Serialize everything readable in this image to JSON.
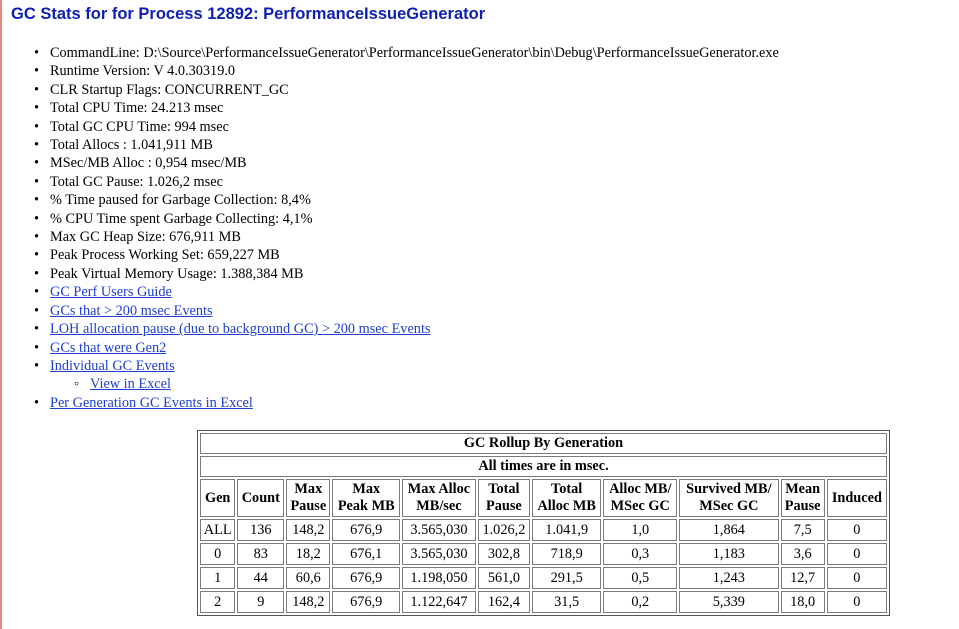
{
  "title": "GC Stats for for Process 12892: PerformanceIssueGenerator",
  "stats": [
    "CommandLine: D:\\Source\\PerformanceIssueGenerator\\PerformanceIssueGenerator\\bin\\Debug\\PerformanceIssueGenerator.exe",
    "Runtime Version: V 4.0.30319.0",
    "CLR Startup Flags: CONCURRENT_GC",
    "Total CPU Time: 24.213 msec",
    "Total GC CPU Time: 994 msec",
    "Total Allocs : 1.041,911 MB",
    "MSec/MB Alloc : 0,954 msec/MB",
    "Total GC Pause: 1.026,2 msec",
    "% Time paused for Garbage Collection: 8,4%",
    "% CPU Time spent Garbage Collecting: 4,1%",
    "Max GC Heap Size: 676,911 MB",
    "Peak Process Working Set: 659,227 MB",
    "Peak Virtual Memory Usage: 1.388,384 MB"
  ],
  "links": {
    "users_guide": "GC Perf Users Guide",
    "gcs_200": "GCs that > 200 msec Events",
    "loh_pause": "LOH allocation pause (due to background GC) > 200 msec Events",
    "gen2": "GCs that were Gen2",
    "individual": "Individual GC Events",
    "view_excel": "View in Excel",
    "per_generation": "Per Generation GC Events in Excel"
  },
  "rollup": {
    "caption": "GC Rollup By Generation",
    "subcaption": "All times are in msec.",
    "headers": [
      [
        "Gen"
      ],
      [
        "Count"
      ],
      [
        "Max",
        "Pause"
      ],
      [
        "Max",
        "Peak MB"
      ],
      [
        "Max Alloc",
        "MB/sec"
      ],
      [
        "Total",
        "Pause"
      ],
      [
        "Total",
        "Alloc MB"
      ],
      [
        "Alloc MB/",
        "MSec GC"
      ],
      [
        "Survived MB/",
        "MSec GC"
      ],
      [
        "Mean",
        "Pause"
      ],
      [
        "Induced"
      ]
    ],
    "rows": [
      [
        "ALL",
        "136",
        "148,2",
        "676,9",
        "3.565,030",
        "1.026,2",
        "1.041,9",
        "1,0",
        "1,864",
        "7,5",
        "0"
      ],
      [
        "0",
        "83",
        "18,2",
        "676,1",
        "3.565,030",
        "302,8",
        "718,9",
        "0,3",
        "1,183",
        "3,6",
        "0"
      ],
      [
        "1",
        "44",
        "60,6",
        "676,9",
        "1.198,050",
        "561,0",
        "291,5",
        "0,5",
        "1,243",
        "12,7",
        "0"
      ],
      [
        "2",
        "9",
        "148,2",
        "676,9",
        "1.122,647",
        "162,4",
        "31,5",
        "0,2",
        "5,339",
        "18,0",
        "0"
      ]
    ]
  }
}
